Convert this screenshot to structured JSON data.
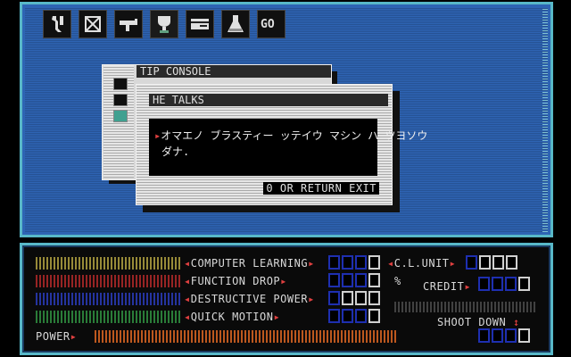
{
  "toolbar": {
    "icons": [
      "wrench-icon",
      "crossed-box-icon",
      "gun-icon",
      "trophy-icon",
      "card-icon",
      "flask-icon"
    ],
    "go_label": "GO"
  },
  "back_window": {
    "title": "TIP CONSOLE"
  },
  "dialog": {
    "title": "HE TALKS",
    "message_line1": "オマエノ ブラスティー ッテイウ マシン ハ ツヨソウ",
    "message_line2": "ダナ.",
    "footer": "0 OR RETURN EXIT"
  },
  "status": {
    "computer_learning": "COMPUTER LEARNING",
    "function_drop": "FUNCTION DROP",
    "destructive_power": "DESTRUCTIVE POWER",
    "quick_motion": "QUICK MOTION",
    "power": "POWER",
    "cl_unit": "C.L.UNIT",
    "percent": "%",
    "credit": "CREDIT",
    "shoot_down": "SHOOT DOWN"
  },
  "colors": {
    "frame_blue": "#2e64b4",
    "gauge_yellow": "#b0a040",
    "gauge_red": "#b02828",
    "gauge_blue": "#2838b0",
    "gauge_green": "#309040",
    "power_orange": "#d06020",
    "digit_blue": "#1e2fb0"
  }
}
